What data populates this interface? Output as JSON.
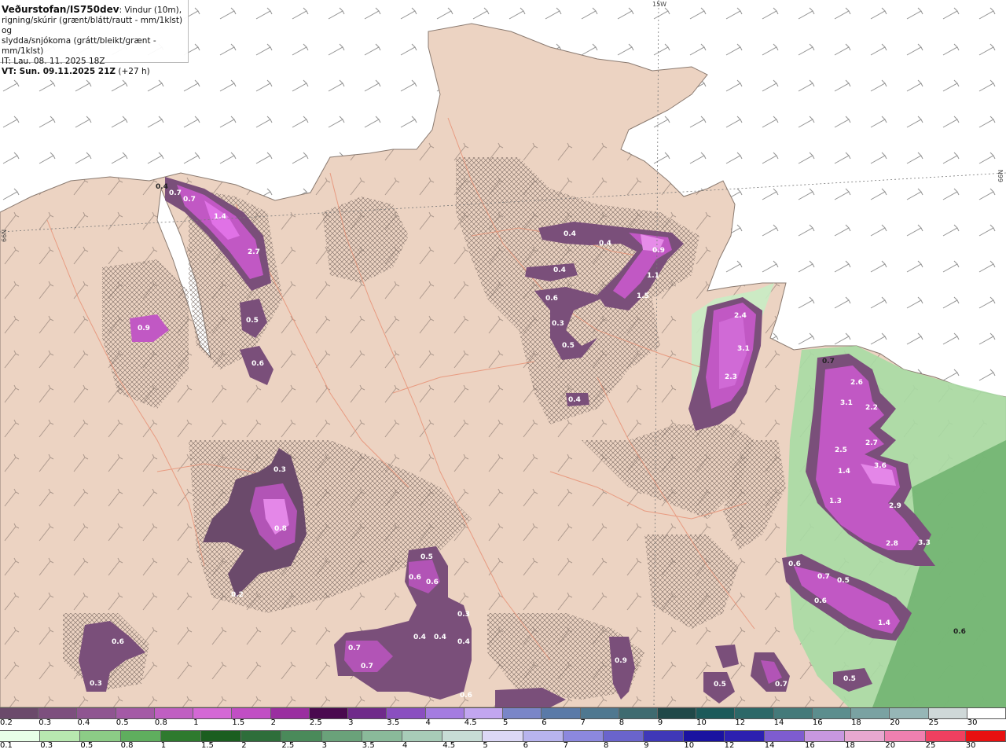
{
  "info": {
    "title": "Veðurstofan/IS750dev",
    "desc1": ": Vindur (10m),",
    "desc2": "rigning/skúrir (grænt/blátt/rautt - mm/1klst) og",
    "desc3": "slydda/snjókoma (grátt/bleikt/grænt - mm/1klst)",
    "it": "IT: Lau. 08. 11. 2025 18Z",
    "vt": "VT: Sun. 09.11.2025 21Z",
    "vt_offset": "(+27 h)"
  },
  "coords": {
    "lon": "15W",
    "lat_left": "66N",
    "lat_right": "66N"
  },
  "labels": [
    "0.4",
    "0.7",
    "0.7",
    "1.4",
    "2.7",
    "0.5",
    "0.6",
    "0.9",
    "0.4",
    "0.4",
    "0.9",
    "0.4",
    "1.1",
    "0.6",
    "1.5",
    "0.3",
    "0.5",
    "0.4",
    "2.4",
    "3.1",
    "2.3",
    "0.7",
    "2.6",
    "3.1",
    "2.2",
    "2.5",
    "2.7",
    "1.4",
    "3.6",
    "1.3",
    "2.9",
    "2.8",
    "3.3",
    "0.3",
    "0.8",
    "0.2",
    "0.5",
    "0.6",
    "0.6",
    "0.3",
    "0.4",
    "0.4",
    "0.4",
    "0.7",
    "0.7",
    "0.6",
    "0.6",
    "0.3",
    "0.9",
    "0.5",
    "0.7",
    "0.6",
    "0.7",
    "0.5",
    "0.6",
    "1.4",
    "0.5",
    "0.6"
  ],
  "scale1": {
    "ticks": [
      "0.2",
      "0.3",
      "0.4",
      "0.5",
      "0.8",
      "1",
      "1.5",
      "2",
      "2.5",
      "3",
      "3.5",
      "4",
      "4.5",
      "5",
      "6",
      "7",
      "8",
      "9",
      "10",
      "12",
      "14",
      "16",
      "18",
      "20",
      "25",
      "30"
    ],
    "colors": [
      "#6b4a6b",
      "#7d4f7e",
      "#8f5591",
      "#a45aa6",
      "#c05fc2",
      "#d468d5",
      "#c14ec4",
      "#9a2fa0",
      "#4a0a4f",
      "#6f2a8a",
      "#8a4fc0",
      "#a47ce0",
      "#c2a6f0",
      "#7a86c8",
      "#5a7aa8",
      "#4f7890",
      "#3f6b70",
      "#204848",
      "#1c5a5a",
      "#2c6868",
      "#447a7a",
      "#5c8e8e",
      "#7aa2a2",
      "#96b6b6",
      "#cfd8d8",
      "#ffffff"
    ]
  },
  "scale2": {
    "ticks": [
      "0.1",
      "0.3",
      "0.5",
      "0.8",
      "1",
      "1.5",
      "2",
      "2.5",
      "3",
      "3.5",
      "4",
      "4.5",
      "5",
      "6",
      "7",
      "8",
      "9",
      "10",
      "12",
      "14",
      "16",
      "18",
      "20",
      "25",
      "30"
    ],
    "colors": [
      "#e8ffe8",
      "#b8e8b0",
      "#8ccc86",
      "#5fae5e",
      "#2e7a2e",
      "#1b5e20",
      "#2e6e3a",
      "#4a8a5a",
      "#6aa27a",
      "#8aba9a",
      "#a8ccb8",
      "#c8ddd6",
      "#dcd8f6",
      "#b8b4ee",
      "#8c88de",
      "#6a64cc",
      "#3f38b8",
      "#1a12a0",
      "#2c20b0",
      "#7e5cd0",
      "#c898e0",
      "#e8a8d0",
      "#f080b0",
      "#f04060",
      "#e81010"
    ]
  }
}
